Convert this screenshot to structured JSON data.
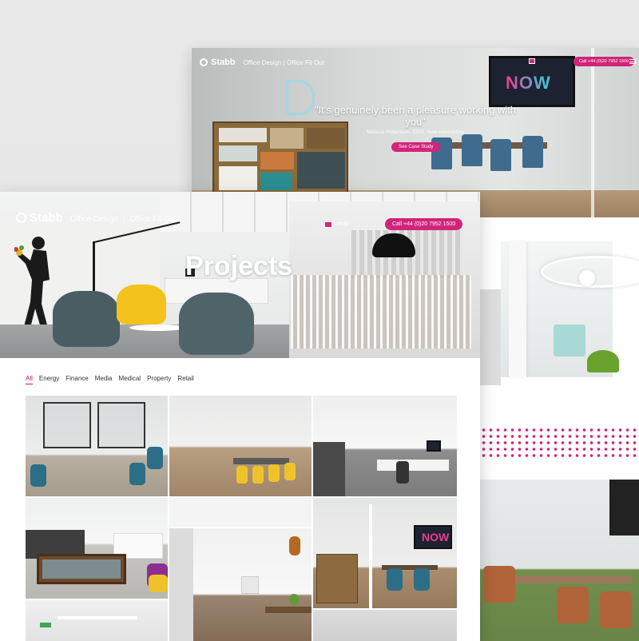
{
  "back_mockup": {
    "brand": "Stabb",
    "nav": [
      "Office Design",
      "|",
      "Office Fit Out"
    ],
    "call_label": "Call +44 (0)20 7952 1500",
    "quote": "\"It's genuinely been a pleasure working with you\"",
    "attribution": "Melissa Robertson, CEO, Now Advertising",
    "cta_label": "See Case Study",
    "tv_text": "NOW"
  },
  "main_mockup": {
    "brand": "Stabb",
    "nav": [
      "Office Design",
      "|",
      "Office Fit Out"
    ],
    "email_label": "info@",
    "call_label": "Call +44 (0)20 7952 1500",
    "title": "Projects",
    "filters": [
      "All",
      "Energy",
      "Finance",
      "Media",
      "Medical",
      "Property",
      "Retail"
    ],
    "active_filter": "All",
    "tile_tv_text": "NOW"
  },
  "colors": {
    "accent": "#d1247a",
    "accent_text": "#c2196c"
  },
  "icons": [
    "logo-mark-icon",
    "mail-icon",
    "menu-icon"
  ]
}
